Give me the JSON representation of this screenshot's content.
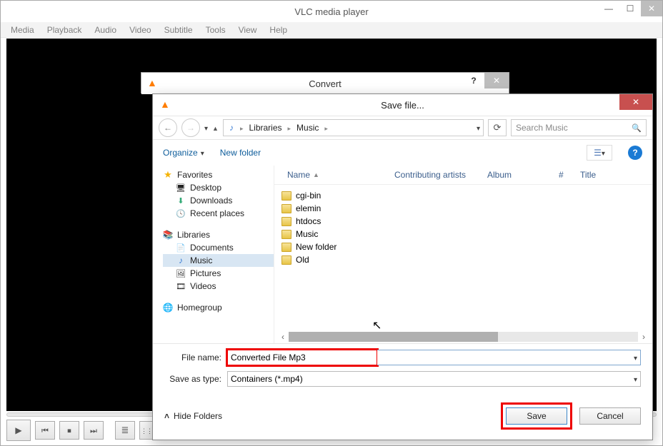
{
  "vlc": {
    "title": "VLC media player",
    "menus": [
      "Media",
      "Playback",
      "Audio",
      "Video",
      "Subtitle",
      "Tools",
      "View",
      "Help"
    ]
  },
  "convert": {
    "title": "Convert",
    "help": "?"
  },
  "save": {
    "title": "Save file...",
    "path": {
      "seg1": "Libraries",
      "seg2": "Music"
    },
    "search_placeholder": "Search Music",
    "toolbar": {
      "organize": "Organize",
      "newfolder": "New folder"
    },
    "tree": {
      "favorites": {
        "label": "Favorites",
        "items": [
          "Desktop",
          "Downloads",
          "Recent places"
        ]
      },
      "libraries": {
        "label": "Libraries",
        "items": [
          "Documents",
          "Music",
          "Pictures",
          "Videos"
        ],
        "selected": "Music"
      },
      "homegroup": {
        "label": "Homegroup"
      }
    },
    "columns": {
      "name": "Name",
      "contrib": "Contributing artists",
      "album": "Album",
      "num": "#",
      "title": "Title"
    },
    "folders": [
      "cgi-bin",
      "elemin",
      "htdocs",
      "Music",
      "New folder",
      "Old"
    ],
    "form": {
      "filename_label": "File name:",
      "filename_value": "Converted File Mp3",
      "type_label": "Save as type:",
      "type_value": "Containers (*.mp4)"
    },
    "footer": {
      "hide": "Hide Folders",
      "save": "Save",
      "cancel": "Cancel"
    }
  }
}
